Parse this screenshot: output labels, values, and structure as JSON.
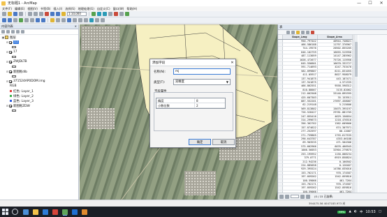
{
  "window": {
    "title": "无标题1 - ArcMap",
    "controls": [
      "—",
      "☐",
      "✕"
    ]
  },
  "menu": [
    "文件(F)",
    "编辑(E)",
    "视图(V)",
    "书签(B)",
    "插入(I)",
    "选择(S)",
    "地理处理(G)",
    "自定义(C)",
    "窗口(W)",
    "帮助(H)"
  ],
  "toolbar": {
    "scale": "1:10,000"
  },
  "toc": {
    "header": "内容列表",
    "close": "×",
    "layers": [
      {
        "label": "图层",
        "indent": 0,
        "expander": "▣",
        "type": "group"
      },
      {
        "label": "11",
        "indent": 1,
        "expander": "⊟",
        "type": "vector",
        "selected": true
      },
      {
        "label": "17",
        "indent": 1,
        "expander": "⊟",
        "type": "vector"
      },
      {
        "label": "ZWJDLTB",
        "indent": 1,
        "expander": "⊟",
        "type": "vector"
      },
      {
        "label": "新图框dlb",
        "indent": 1,
        "expander": "⊟",
        "type": "vector"
      },
      {
        "label": "371524AP0DOM.img",
        "indent": 1,
        "expander": "⊟",
        "type": "raster"
      },
      {
        "label": "RGB",
        "indent": 2,
        "type": "text"
      },
      {
        "label": "红色:  Layer_1",
        "indent": 2,
        "type": "band",
        "color": "#e23b3b"
      },
      {
        "label": "绿色:  Layer_2",
        "indent": 2,
        "type": "band",
        "color": "#3ab04a"
      },
      {
        "label": "蓝色:  Layer_3",
        "indent": 2,
        "type": "band",
        "color": "#2f5fe0"
      },
      {
        "label": "新图框ZDW",
        "indent": 1,
        "expander": "⊟",
        "type": "vector"
      }
    ]
  },
  "dialog": {
    "title": "添加字段",
    "name_label": "名称(N):",
    "name_value": "mj",
    "type_label": "类型(T):",
    "type_value": "双精度",
    "props_group": "字段属性",
    "props": [
      {
        "key": "精度",
        "value": "8"
      },
      {
        "key": "小数位数",
        "value": "2"
      }
    ],
    "ok_label": "确定",
    "cancel_label": "取消",
    "close": "✕"
  },
  "attribute_table": {
    "title": "表",
    "columns": [
      "Shape_Leng",
      "Shape_Area"
    ],
    "rows": [
      [
        "950.797442",
        "40944.748021"
      ],
      [
        "466.586188",
        "11797.376967"
      ],
      [
        "744.19576",
        "20502.855205"
      ],
      [
        "846.102759",
        "16655.515956"
      ],
      [
        "487.113059",
        "14147.285962"
      ],
      [
        "1028.472677",
        "75726.115956"
      ],
      [
        "845.556601",
        "16670.332727"
      ],
      [
        "591.714693",
        "4247.753476"
      ],
      [
        "582.099887",
        "6211.831055"
      ],
      [
        "411.05917",
        "8027.958079"
      ],
      [
        "137.941875",
        "443.187471"
      ],
      [
        "137.941875",
        "4.571335"
      ],
      [
        "466.862551",
        "9558.598312"
      ],
      [
        "810.88007",
        "3135.82062"
      ],
      [
        "212.662508",
        "33140.895395"
      ],
      [
        "425.607303",
        "35.153911"
      ],
      [
        "887.552201",
        "27697.458087"
      ],
      [
        "62.219148",
        "5.215606"
      ],
      [
        "569.813802",
        "15075.395197"
      ],
      [
        "726.528427",
        "29781.881705"
      ],
      [
        "247.855416",
        "4629.156654"
      ],
      [
        "314.299673",
        "1218.476516"
      ],
      [
        "356.362762",
        "1362.609666"
      ],
      [
        "157.074622",
        "674.307971"
      ],
      [
        "277.252597",
        "80.12087"
      ],
      [
        "271.759865",
        "1755.617535"
      ],
      [
        "290.643787",
        "4353.06188"
      ],
      [
        "69.903535",
        "471.504306"
      ],
      [
        "575.662966",
        "6076.466945"
      ],
      [
        "1006.56053",
        "32904.279875"
      ],
      [
        "253.195952",
        "1150.008234"
      ],
      [
        "379.0771",
        "6919.858824"
      ],
      [
        "212.94236",
        "0.100502"
      ],
      [
        "224.885058",
        "0.126467"
      ],
      [
        "929.395524",
        "14786.035016"
      ],
      [
        "153.762171",
        "970.174587"
      ],
      [
        "197.059262",
        "1542.059816"
      ],
      [
        "100.59066",
        "461.7264"
      ],
      [
        "153.762171",
        "970.174587"
      ],
      [
        "197.059262",
        "1542.059816"
      ],
      [
        "100.59066",
        "461.7264"
      ]
    ],
    "status_text": "(0 / 15 已选择)",
    "tab_label": "1 1"
  },
  "statusbar": {
    "coords": "394475.56 4047183.973 米"
  },
  "taskbar": {
    "battery": "99%",
    "ime": "中",
    "time": "10:53"
  }
}
